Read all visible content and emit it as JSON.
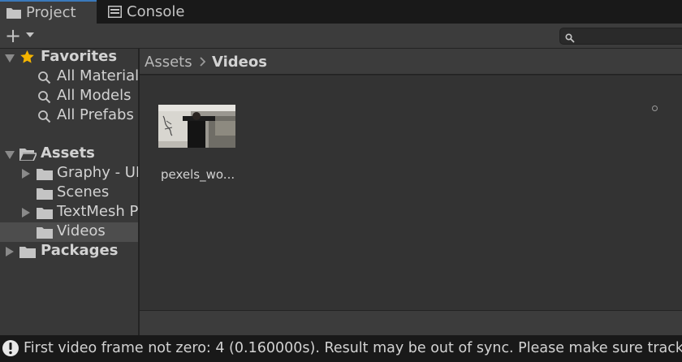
{
  "tabs": [
    {
      "label": "Project",
      "icon": "folder-icon"
    },
    {
      "label": "Console",
      "icon": "console-icon"
    }
  ],
  "toolbar": {
    "add_icon": "plus-icon",
    "search_value": ""
  },
  "tree": {
    "favorites": {
      "label": "Favorites",
      "items": [
        "All Material",
        "All Models",
        "All Prefabs"
      ]
    },
    "assets": {
      "label": "Assets",
      "items": [
        "Graphy - UI",
        "Scenes",
        "TextMesh Pro",
        "Videos"
      ]
    },
    "packages": {
      "label": "Packages"
    }
  },
  "breadcrumb": [
    "Assets",
    "Videos"
  ],
  "content": {
    "assets": [
      {
        "name": "pexels_wo..."
      }
    ]
  },
  "status": {
    "message": "First video frame not zero: 4 (0.160000s). Result may be out of sync. Please make sure tracks"
  },
  "colors": {
    "accent": "#3a79bb",
    "favorites_star": "#f4b400"
  }
}
